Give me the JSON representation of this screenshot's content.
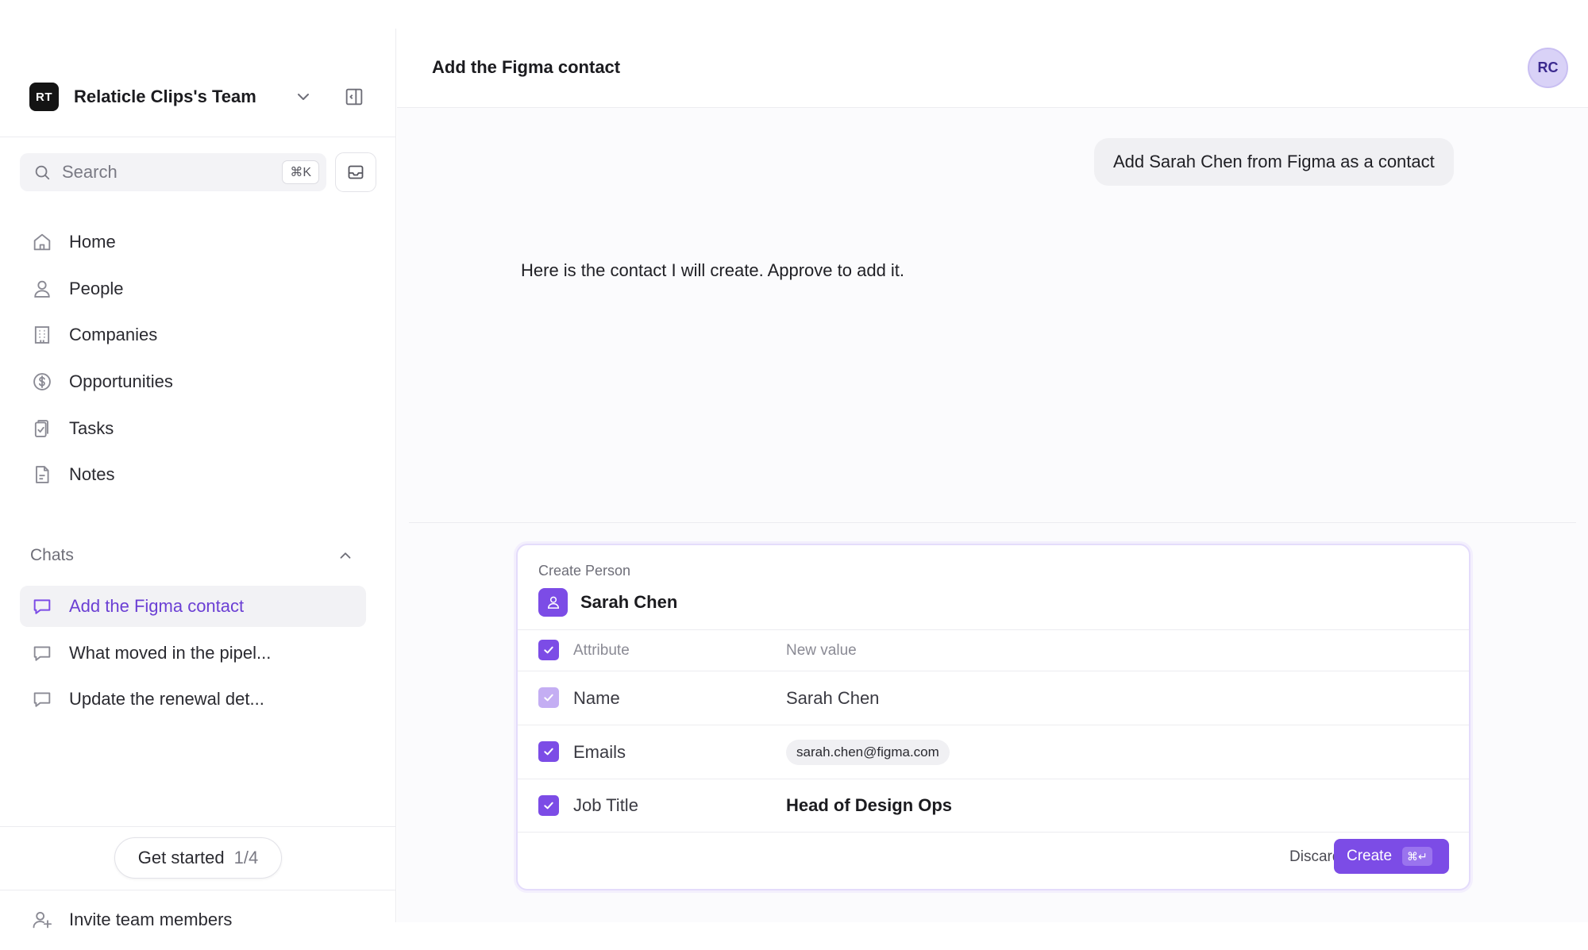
{
  "sidebar": {
    "team_logo": "RT",
    "team_name": "Relaticle Clips's Team",
    "search_placeholder": "Search",
    "search_shortcut": "⌘K",
    "nav": [
      {
        "label": "Home",
        "icon": "home-icon"
      },
      {
        "label": "People",
        "icon": "person-icon"
      },
      {
        "label": "Companies",
        "icon": "building-icon"
      },
      {
        "label": "Opportunities",
        "icon": "dollar-icon"
      },
      {
        "label": "Tasks",
        "icon": "clipboard-check-icon"
      },
      {
        "label": "Notes",
        "icon": "document-icon"
      }
    ],
    "chats_heading": "Chats",
    "chats": [
      {
        "label": "Add the Figma contact",
        "active": true
      },
      {
        "label": "What moved in the pipel...",
        "active": false
      },
      {
        "label": "Update the renewal det...",
        "active": false
      }
    ],
    "get_started": {
      "label": "Get started",
      "progress": "1/4"
    },
    "invite_label": "Invite team members"
  },
  "main": {
    "title": "Add the Figma contact",
    "avatar_initials": "RC",
    "user_message": "Add Sarah Chen from Figma as a contact",
    "assistant_message": "Here is the contact I will create. Approve to add it."
  },
  "card": {
    "kicker": "Create Person",
    "person_name": "Sarah Chen",
    "header": {
      "attribute": "Attribute",
      "value": "New value"
    },
    "rows": [
      {
        "attribute": "Name",
        "value": "Sarah Chen"
      },
      {
        "attribute": "Emails",
        "value": "sarah.chen@figma.com"
      },
      {
        "attribute": "Job Title",
        "value": "Head of Design Ops"
      }
    ],
    "discard_label": "Discard",
    "create_label": "Create",
    "create_shortcut": "⌘↵"
  },
  "colors": {
    "accent": "#7c4ce6",
    "accent_light": "#c4aef3",
    "active_text": "#6b3fd4"
  }
}
